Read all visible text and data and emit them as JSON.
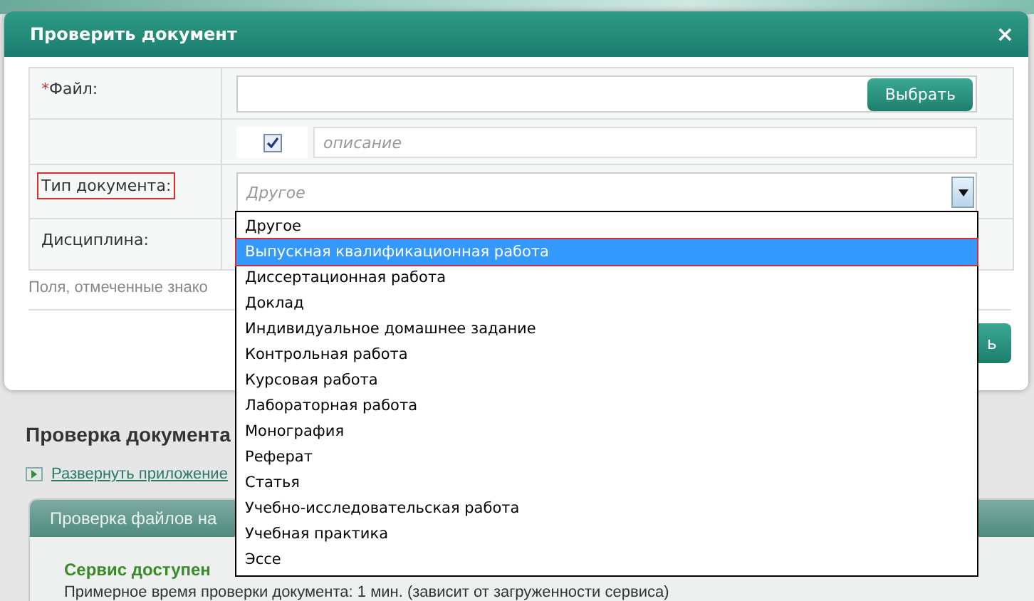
{
  "dialog": {
    "title": "Проверить документ",
    "close": "×"
  },
  "form": {
    "file": {
      "required_mark": "*",
      "label": "Файл:",
      "button": "Выбрать"
    },
    "description": {
      "checked": true,
      "placeholder": "описание"
    },
    "doc_type": {
      "label": "Тип документа:",
      "value": "Другое",
      "highlighted": true
    },
    "discipline": {
      "label": "Дисциплина:"
    },
    "note": "Поля, отмеченные знако"
  },
  "footer_button": "ь",
  "dropdown": {
    "options": [
      {
        "label": "Другое",
        "selected": false,
        "highlighted": false
      },
      {
        "label": "Выпускная квалификационная работа",
        "selected": true,
        "highlighted": true
      },
      {
        "label": "Диссертационная работа",
        "selected": false,
        "highlighted": false
      },
      {
        "label": "Доклад",
        "selected": false,
        "highlighted": false
      },
      {
        "label": "Индивидуальное домашнее задание",
        "selected": false,
        "highlighted": false
      },
      {
        "label": "Контрольная работа",
        "selected": false,
        "highlighted": false
      },
      {
        "label": "Курсовая работа",
        "selected": false,
        "highlighted": false
      },
      {
        "label": "Лабораторная работа",
        "selected": false,
        "highlighted": false
      },
      {
        "label": "Монография",
        "selected": false,
        "highlighted": false
      },
      {
        "label": "Реферат",
        "selected": false,
        "highlighted": false
      },
      {
        "label": "Статья",
        "selected": false,
        "highlighted": false
      },
      {
        "label": "Учебно-исследовательская работа",
        "selected": false,
        "highlighted": false
      },
      {
        "label": "Учебная практика",
        "selected": false,
        "highlighted": false
      },
      {
        "label": "Эссе",
        "selected": false,
        "highlighted": false
      }
    ]
  },
  "page": {
    "heading": "Проверка документа",
    "link": "Развернуть приложение",
    "panel_title": "Проверка файлов на",
    "status": "Сервис доступен",
    "time": "Примерное время проверки документа: 1 мин. (зависит от загруженности сервиса)"
  }
}
